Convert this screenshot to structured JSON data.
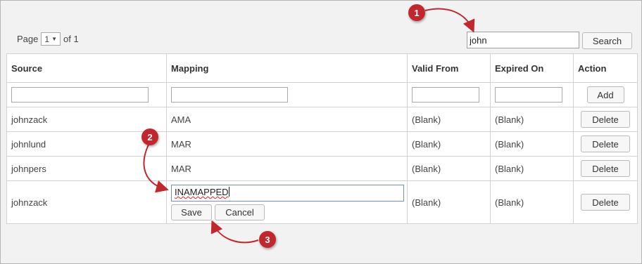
{
  "pager": {
    "prefix": "Page",
    "current_page": "1",
    "suffix": "of 1"
  },
  "search": {
    "value": "john",
    "button_label": "Search"
  },
  "table": {
    "columns": [
      "Source",
      "Mapping",
      "Valid From",
      "Expired On",
      "Action"
    ],
    "add_label": "Add",
    "rows": [
      {
        "source": "johnzack",
        "mapping": "AMA",
        "valid_from": "(Blank)",
        "expired_on": "(Blank)",
        "action": "Delete"
      },
      {
        "source": "johnlund",
        "mapping": "MAR",
        "valid_from": "(Blank)",
        "expired_on": "(Blank)",
        "action": "Delete"
      },
      {
        "source": "johnpers",
        "mapping": "MAR",
        "valid_from": "(Blank)",
        "expired_on": "(Blank)",
        "action": "Delete"
      }
    ],
    "edit_row": {
      "source": "johnzack",
      "mapping_value": "INAMAPPED",
      "save_label": "Save",
      "cancel_label": "Cancel",
      "valid_from": "(Blank)",
      "expired_on": "(Blank)",
      "action": "Delete"
    }
  },
  "callouts": [
    "1",
    "2",
    "3"
  ],
  "colors": {
    "callout": "#c1272d",
    "edit_focus_border": "#6e8fd8"
  }
}
